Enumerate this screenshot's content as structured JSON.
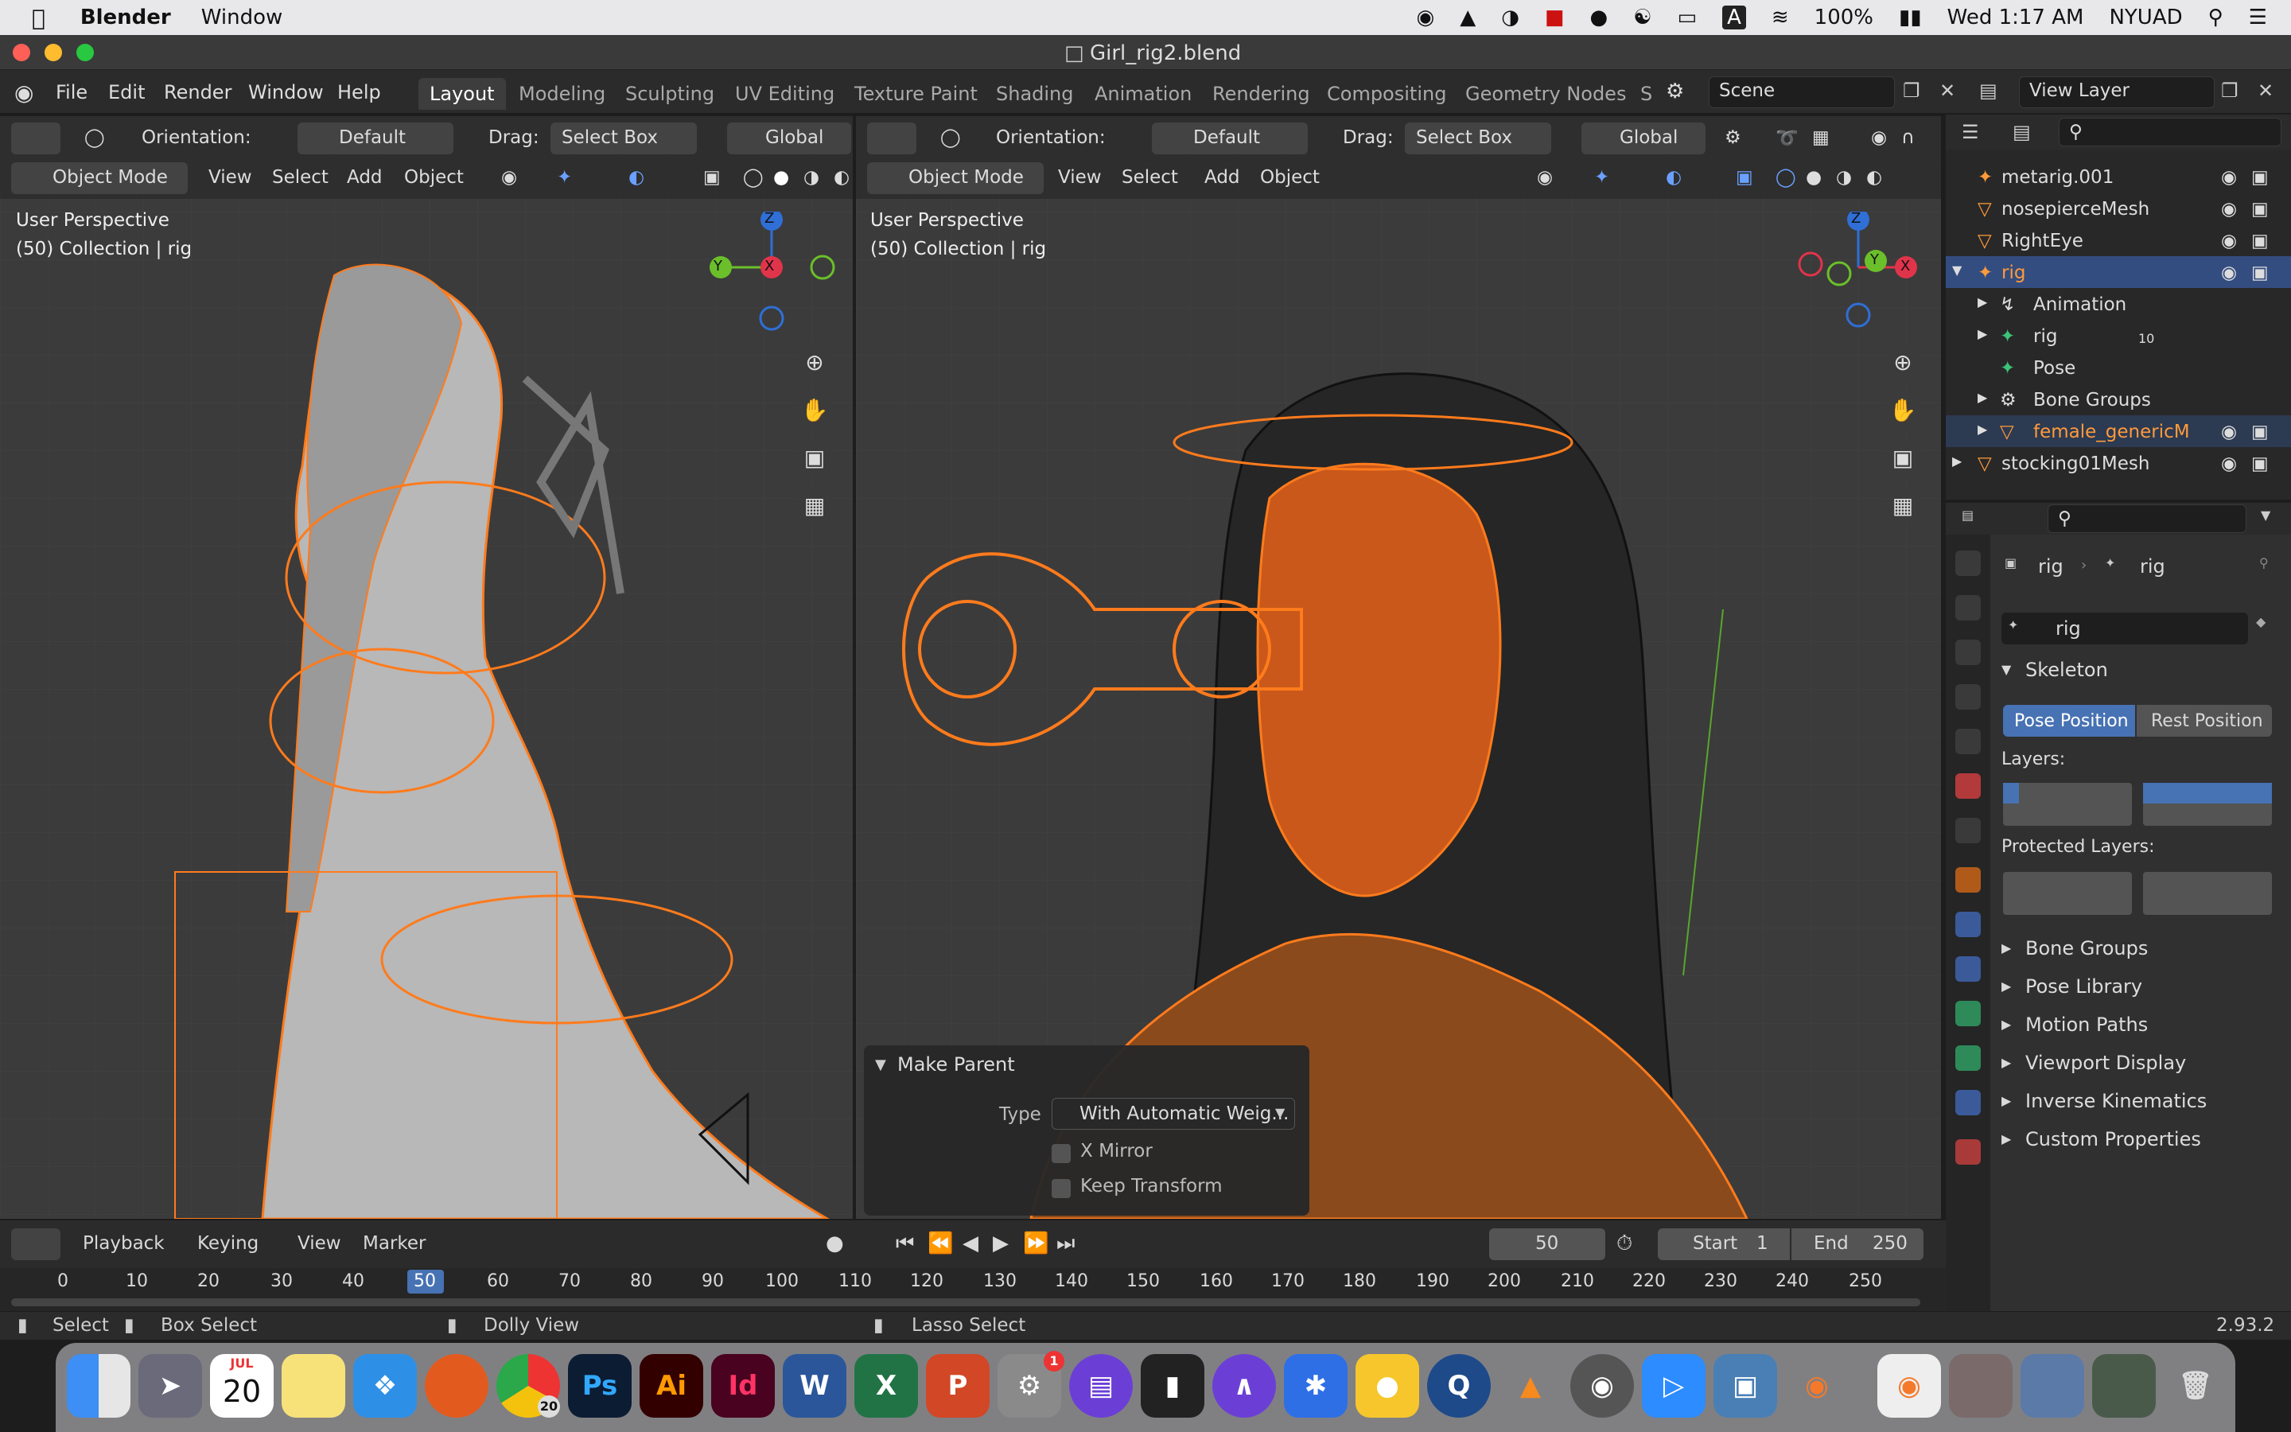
{
  "macos_menu": {
    "app": "Blender",
    "window": "Window",
    "battery": "100%",
    "clock": "Wed 1:17 AM",
    "user": "NYUAD"
  },
  "window": {
    "title": "Girl_rig2.blend"
  },
  "menu": [
    "File",
    "Edit",
    "Render",
    "Window",
    "Help"
  ],
  "workspaces": [
    "Layout",
    "Modeling",
    "Sculpting",
    "UV Editing",
    "Texture Paint",
    "Shading",
    "Animation",
    "Rendering",
    "Compositing",
    "Geometry Nodes",
    "S"
  ],
  "scene": "Scene",
  "view_layer": "View Layer",
  "viewport_header": {
    "orientation_label": "Orientation:",
    "orientation_value": "Default",
    "drag_label": "Drag:",
    "drag_value": "Select Box",
    "transform": "Global",
    "mode": "Object Mode",
    "menus": [
      "View",
      "Select",
      "Add",
      "Object"
    ]
  },
  "viewport_left": {
    "perspective": "User Perspective",
    "collection": "(50) Collection | rig"
  },
  "viewport_right": {
    "perspective": "User Perspective",
    "collection": "(50) Collection | rig"
  },
  "gizmo": {
    "x": "X",
    "y": "Y",
    "z": "Z"
  },
  "make_parent": {
    "title": "Make Parent",
    "type_label": "Type",
    "type_value": "With Automatic Weig...",
    "x_mirror": "X Mirror",
    "keep_transform": "Keep Transform"
  },
  "outliner": [
    {
      "name": "metarig.001",
      "indent": 0
    },
    {
      "name": "nosepierceMesh",
      "indent": 0
    },
    {
      "name": "RightEye",
      "indent": 0
    },
    {
      "name": "rig",
      "indent": 0
    },
    {
      "name": "Animation",
      "indent": 1
    },
    {
      "name": "rig",
      "indent": 1
    },
    {
      "name": "Pose",
      "indent": 1
    },
    {
      "name": "Bone Groups",
      "indent": 1
    },
    {
      "name": "female_genericM",
      "indent": 1
    },
    {
      "name": "stocking01Mesh",
      "indent": 0
    }
  ],
  "outliner_badge": "10",
  "properties": {
    "breadcrumb_a": "rig",
    "breadcrumb_b": "rig",
    "data_name": "rig",
    "skeleton": "Skeleton",
    "pose_position": "Pose Position",
    "rest_position": "Rest Position",
    "layers": "Layers:",
    "protected_layers": "Protected Layers:",
    "panels": [
      "Bone Groups",
      "Pose Library",
      "Motion Paths",
      "Viewport Display",
      "Inverse Kinematics",
      "Custom Properties"
    ]
  },
  "timeline": {
    "menus": [
      "Playback",
      "Keying",
      "View",
      "Marker"
    ],
    "current_frame": "50",
    "start_label": "Start",
    "start_value": "1",
    "end_label": "End",
    "end_value": "250",
    "ticks": [
      "0",
      "10",
      "20",
      "30",
      "40",
      "50",
      "60",
      "70",
      "80",
      "90",
      "100",
      "110",
      "120",
      "130",
      "140",
      "150",
      "160",
      "170",
      "180",
      "190",
      "200",
      "210",
      "220",
      "230",
      "240",
      "250"
    ]
  },
  "statusbar": {
    "select": "Select",
    "box_select": "Box Select",
    "dolly": "Dolly View",
    "lasso": "Lasso Select",
    "version": "2.93.2"
  },
  "dock": {
    "calendar_month": "JUL",
    "calendar_day": "20",
    "chrome_badge": "20",
    "ps": "Ps",
    "ai": "Ai",
    "id": "Id",
    "settings_badge": "1"
  },
  "colors": {
    "accent": "#ff8a1f",
    "selection": "#334d80",
    "active_button": "#4772b3"
  }
}
